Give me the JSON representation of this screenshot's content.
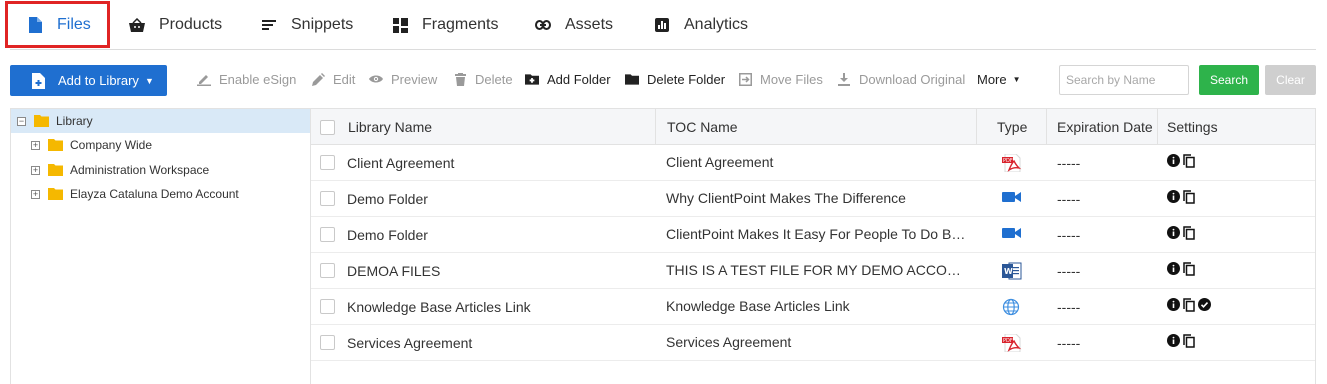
{
  "nav": {
    "tabs": [
      {
        "label": "Files",
        "icon": "file-icon",
        "active": true
      },
      {
        "label": "Products",
        "icon": "basket-icon"
      },
      {
        "label": "Snippets",
        "icon": "snippets-icon"
      },
      {
        "label": "Fragments",
        "icon": "fragments-icon"
      },
      {
        "label": "Assets",
        "icon": "link-icon"
      },
      {
        "label": "Analytics",
        "icon": "analytics-icon"
      }
    ]
  },
  "toolbar": {
    "add_label": "Add to Library",
    "enable_esign": "Enable eSign",
    "edit": "Edit",
    "preview": "Preview",
    "delete": "Delete",
    "add_folder": "Add Folder",
    "delete_folder": "Delete Folder",
    "move_files": "Move Files",
    "download_original": "Download Original",
    "more": "More",
    "search_placeholder": "Search by Name",
    "search_label": "Search",
    "clear_label": "Clear"
  },
  "tree": {
    "root": "Library",
    "children": [
      "Company Wide",
      "Administration Workspace",
      "Elayza Cataluna Demo Account"
    ]
  },
  "table": {
    "headers": {
      "name": "Library Name",
      "toc": "TOC Name",
      "type": "Type",
      "expiration": "Expiration Date",
      "settings": "Settings"
    },
    "rows": [
      {
        "name": "Client Agreement",
        "toc": "Client Agreement",
        "type": "pdf",
        "expiration": "-----",
        "verified": false
      },
      {
        "name": "Demo Folder",
        "toc": "Why ClientPoint Makes The Difference",
        "type": "video",
        "expiration": "-----",
        "verified": false
      },
      {
        "name": "Demo Folder",
        "toc": "ClientPoint Makes It Easy For People To Do Business With You",
        "type": "video",
        "expiration": "-----",
        "verified": false
      },
      {
        "name": "DEMOA FILES",
        "toc": "THIS IS A TEST FILE FOR MY DEMO ACCOUNT",
        "type": "word",
        "expiration": "-----",
        "verified": false
      },
      {
        "name": "Knowledge Base Articles Link",
        "toc": "Knowledge Base Articles Link",
        "type": "link",
        "expiration": "-----",
        "verified": true
      },
      {
        "name": "Services Agreement",
        "toc": "Services Agreement",
        "type": "pdf",
        "expiration": "-----",
        "verified": false
      }
    ]
  },
  "colors": {
    "primary": "#1f6fd0",
    "success": "#2eb34b",
    "highlight": "#e02424",
    "selection": "#d9e9f7",
    "folder": "#f5b800"
  }
}
